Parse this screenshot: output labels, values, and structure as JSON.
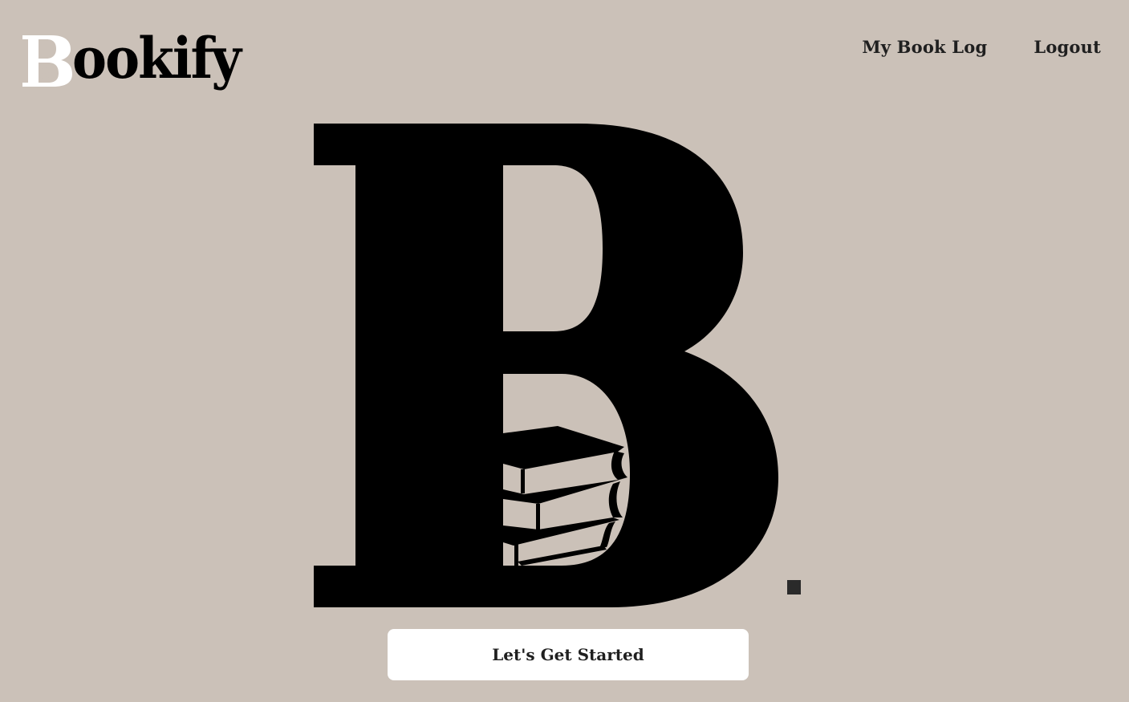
{
  "header": {
    "logo_initial": "B",
    "logo_text": "ookify",
    "nav": [
      {
        "label": "My Book Log"
      },
      {
        "label": "Logout"
      }
    ]
  },
  "hero": {
    "icon": "bookify-b-logo-with-book-stack",
    "cta_label": "Let's Get Started"
  },
  "colors": {
    "background": "#cbc1b8",
    "logo": "#000000",
    "button_bg": "#ffffff",
    "text": "#1f1f1f"
  }
}
